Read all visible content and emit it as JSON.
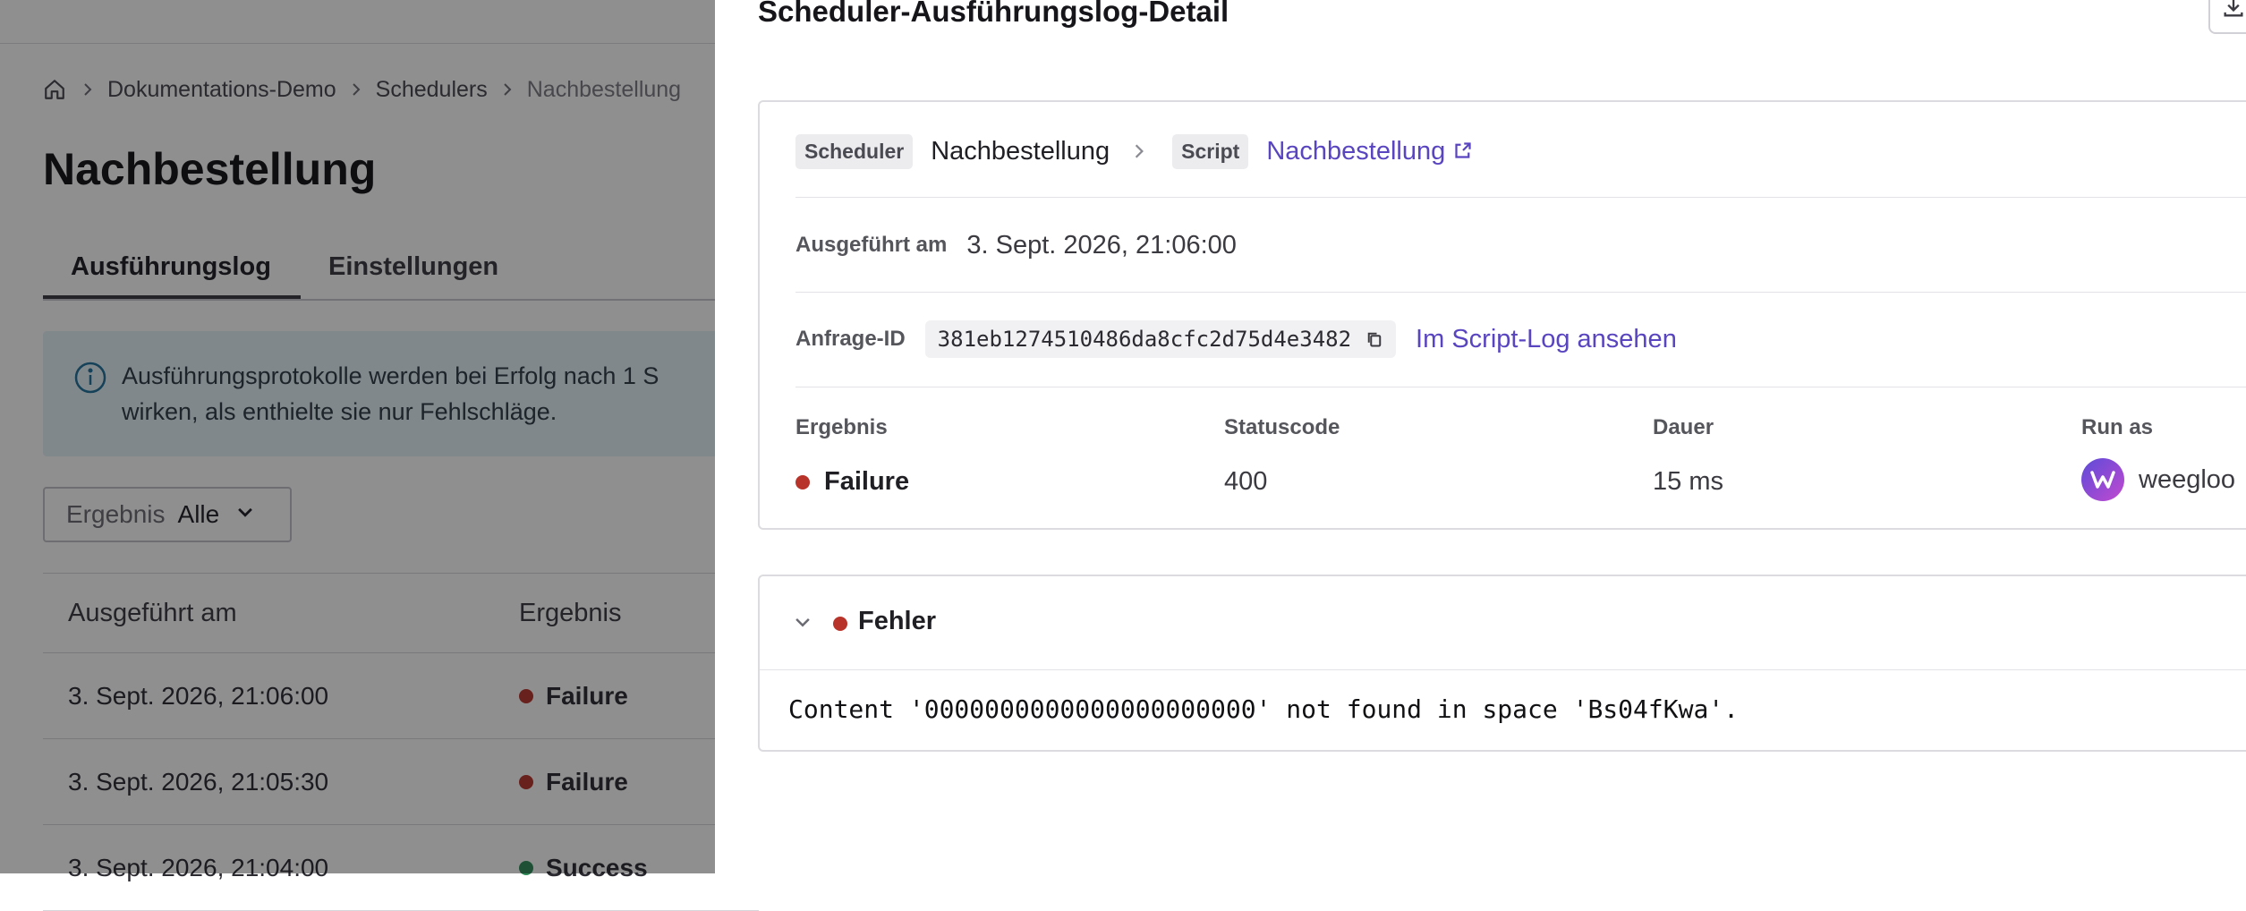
{
  "page": {
    "breadcrumb": [
      "Dokumentations-Demo",
      "Schedulers",
      "Nachbestellung"
    ],
    "title": "Nachbestellung",
    "tabs": [
      {
        "label": "Ausführungslog",
        "active": true
      },
      {
        "label": "Einstellungen",
        "active": false
      }
    ],
    "info": {
      "line1": "Ausführungsprotokolle werden bei Erfolg nach 1 S",
      "line2": "wirken, als enthielte sie nur Fehlschläge."
    },
    "filter": {
      "label": "Ergebnis",
      "value": "Alle"
    },
    "table": {
      "columns": [
        "Ausgeführt am",
        "Ergebnis"
      ],
      "rows": [
        {
          "date": "3. Sept. 2026, 21:06:00",
          "result": "Failure",
          "status": "failure"
        },
        {
          "date": "3. Sept. 2026, 21:05:30",
          "result": "Failure",
          "status": "failure"
        },
        {
          "date": "3. Sept. 2026, 21:04:00",
          "result": "Success",
          "status": "success"
        }
      ]
    }
  },
  "drawer": {
    "title": "Scheduler-Ausführungslog-Detail",
    "scheduler_tag": "Scheduler",
    "scheduler_name": "Nachbestellung",
    "script_tag": "Script",
    "script_link": "Nachbestellung",
    "executed_label": "Ausgeführt am",
    "executed_value": "3. Sept. 2026, 21:06:00",
    "request_label": "Anfrage-ID",
    "request_id": "381eb1274510486da8cfc2d75d4e3482",
    "script_log_link": "Im Script-Log ansehen",
    "result_label": "Ergebnis",
    "result_value": "Failure",
    "status_label": "Statuscode",
    "status_value": "400",
    "duration_label": "Dauer",
    "duration_value": "15 ms",
    "run_as_label": "Run as",
    "run_as_value": "weegloo",
    "error_title": "Fehler",
    "error_message": "Content '0000000000000000000000' not found in space 'Bs04fKwa'."
  },
  "colors": {
    "failure": "#b8342a",
    "success": "#2e8b57",
    "link": "#5a45c0",
    "overlay": "rgba(10,10,14,0.46)"
  },
  "icons": [
    "home-icon",
    "chevron-right-icon",
    "info-icon",
    "chevron-down-icon",
    "download-icon",
    "external-link-icon",
    "copy-icon",
    "avatar-logo-icon"
  ]
}
